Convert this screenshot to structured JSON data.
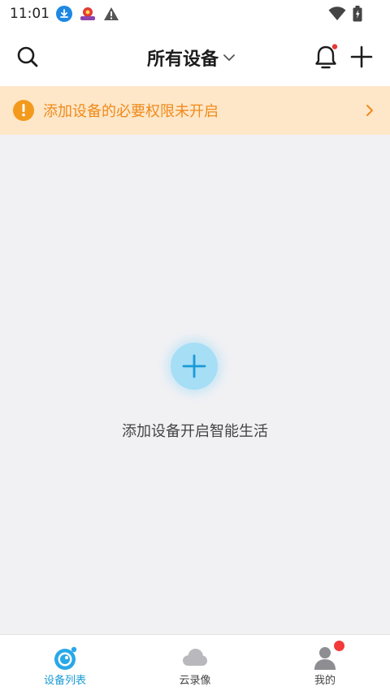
{
  "status_bar": {
    "time": "11:01",
    "icons": [
      "download-icon",
      "app-notification-icon",
      "warning-icon",
      "wifi-icon",
      "battery-icon"
    ]
  },
  "header": {
    "title": "所有设备",
    "icons": [
      "search-icon",
      "chevron-down-icon",
      "bell-icon",
      "plus-icon"
    ],
    "notification_dot_color": "#e53935"
  },
  "banner": {
    "text": "添加设备的必要权限未开启",
    "icon": "exclamation-icon",
    "bg_color": "#fde7c8",
    "text_color": "#f08a1c"
  },
  "empty_state": {
    "text": "添加设备开启智能生活",
    "icon": "add-device-icon",
    "accent": "#1a9ad6"
  },
  "tab_bar": {
    "tabs": [
      {
        "label": "设备列表",
        "icon": "camera-icon",
        "active": true
      },
      {
        "label": "云录像",
        "icon": "cloud-icon",
        "active": false
      },
      {
        "label": "我的",
        "icon": "person-icon",
        "active": false,
        "badge": true
      }
    ],
    "active_color": "#1a9ad6"
  }
}
